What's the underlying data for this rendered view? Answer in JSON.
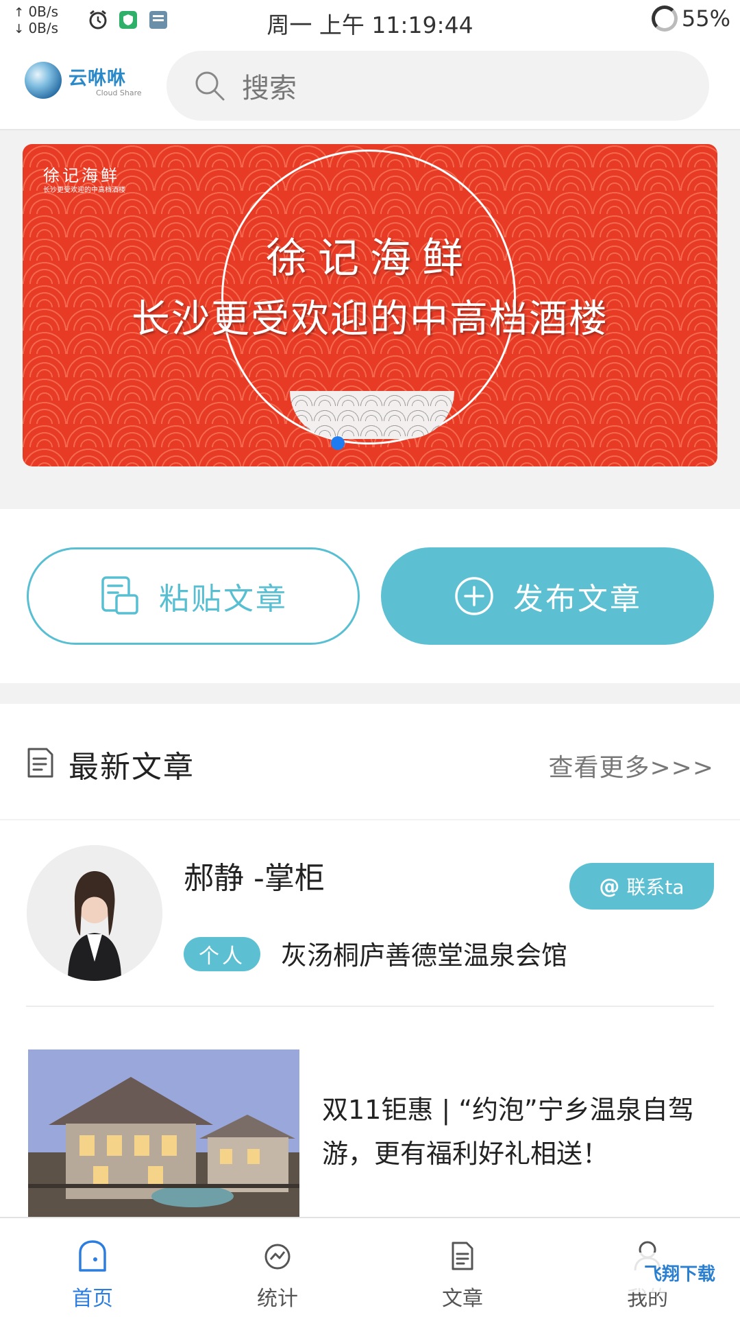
{
  "status_bar": {
    "net_up": "0B/s",
    "net_down": "0B/s",
    "time": "周一 上午 11:19:44",
    "battery": "55%"
  },
  "header": {
    "logo_cn": "云咻咻",
    "logo_en": "Cloud Share",
    "search_placeholder": "搜索"
  },
  "banner": {
    "brand_small": "徐记海鲜",
    "brand_small_sub": "长沙更受欢迎的中高档酒楼",
    "title": "徐记海鲜",
    "subtitle": "长沙更受欢迎的中高档酒楼"
  },
  "actions": {
    "paste_label": "粘贴文章",
    "publish_label": "发布文章"
  },
  "latest": {
    "title": "最新文章",
    "more": "查看更多>>>"
  },
  "card": {
    "name": "郝静 -掌柜",
    "contact_label": "联系ta",
    "tag": "个人",
    "org": "灰汤桐庐善德堂温泉会馆",
    "article_title": "双11钜惠 | “约泡”宁乡温泉自驾游，更有福利好礼相送！"
  },
  "nav": {
    "items": [
      {
        "label": "首页",
        "icon": "home-icon",
        "active": true
      },
      {
        "label": "统计",
        "icon": "stats-icon",
        "active": false
      },
      {
        "label": "文章",
        "icon": "article-icon",
        "active": false
      },
      {
        "label": "我的",
        "icon": "profile-icon",
        "active": false
      }
    ]
  },
  "watermark": "飞翔下载",
  "colors": {
    "accent": "#5cc0d2",
    "nav_active": "#2c7de0",
    "banner_red": "#e73b26"
  }
}
